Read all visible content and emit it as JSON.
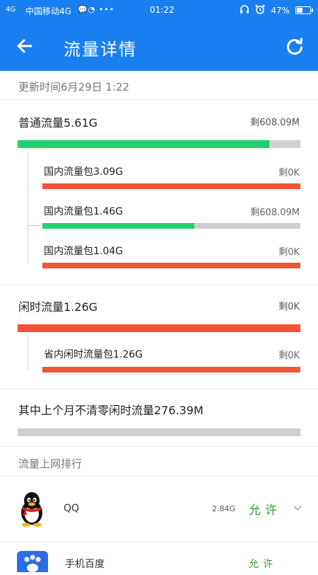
{
  "status_bar": {
    "signal": "4G",
    "carrier": "中国移动4G",
    "time": "01:22",
    "battery": "47%",
    "battery_level": 0.47
  },
  "header": {
    "title": "流量详情"
  },
  "update_time": "更新时间6月29日 1:22",
  "general": {
    "label": "普通流量5.61G",
    "remaining": "剩608.09M",
    "used_fraction": 0.89,
    "color": "#21d16c",
    "packages": [
      {
        "label": "国内流量包3.09G",
        "remaining": "剩0K",
        "used_fraction": 1.0,
        "color": "#f25235"
      },
      {
        "label": "国内流量包1.46G",
        "remaining": "剩608.09M",
        "used_fraction": 0.59,
        "color": "#21d16c"
      },
      {
        "label": "国内流量包1.04G",
        "remaining": "剩0K",
        "used_fraction": 1.0,
        "color": "#f25235"
      }
    ]
  },
  "idle": {
    "label": "闲时流量1.26G",
    "remaining": "剩0K",
    "used_fraction": 1.0,
    "color": "#f25235",
    "packages": [
      {
        "label": "省内闲时流量包1.26G",
        "remaining": "剩0K",
        "used_fraction": 1.0,
        "color": "#f25235"
      }
    ]
  },
  "carryover": {
    "label": "其中上个月不清零闲时流量276.39M",
    "used_fraction": 0
  },
  "ranking": {
    "title": "流量上网排行",
    "apps": [
      {
        "name": "QQ",
        "usage": "2.84G",
        "permission": "允许",
        "icon": "qq-penguin-icon"
      }
    ],
    "next_app_partial_name": "手机百度",
    "next_app_partial_permission": "允许"
  },
  "colors": {
    "header": "#1a7ff0",
    "green": "#21d16c",
    "red": "#f25235",
    "track": "#cfcfcf",
    "allow": "#2e9e2e"
  }
}
